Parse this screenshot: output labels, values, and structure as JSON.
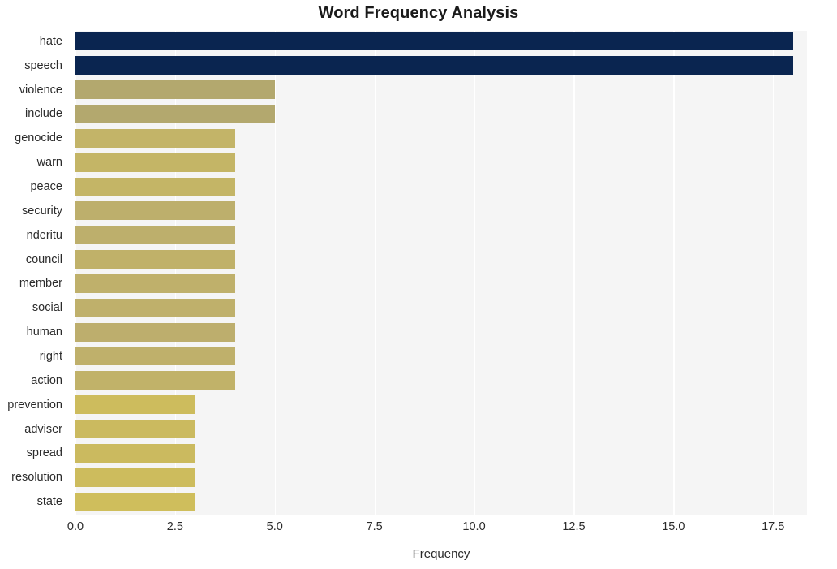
{
  "chart": {
    "title": "Word Frequency Analysis",
    "xlabel": "Frequency",
    "ylabel": ""
  },
  "chart_data": {
    "type": "bar",
    "orientation": "horizontal",
    "title": "Word Frequency Analysis",
    "xlabel": "Frequency",
    "ylabel": "",
    "categories": [
      "hate",
      "speech",
      "violence",
      "include",
      "genocide",
      "warn",
      "peace",
      "security",
      "nderitu",
      "council",
      "member",
      "social",
      "human",
      "right",
      "action",
      "prevention",
      "adviser",
      "spread",
      "resolution",
      "state"
    ],
    "values": [
      18,
      18,
      5,
      5,
      4,
      4,
      4,
      4,
      4,
      4,
      4,
      4,
      4,
      4,
      4,
      3,
      3,
      3,
      3,
      3
    ],
    "bar_colors": [
      "#0a2550",
      "#0a2550",
      "#b3a86e",
      "#b3a86e",
      "#c3b468",
      "#c4b566",
      "#c4b566",
      "#bdaf6c",
      "#bdaf6c",
      "#c0b169",
      "#bfb06b",
      "#bfb06b",
      "#bdae6d",
      "#bfb06b",
      "#c1b269",
      "#cdbc5d",
      "#cbba5f",
      "#cbba5f",
      "#cdbc5d",
      "#cfbe5c"
    ],
    "xticks": [
      0.0,
      2.5,
      5.0,
      7.5,
      10.0,
      12.5,
      15.0,
      17.5
    ],
    "xtick_labels": [
      "0.0",
      "2.5",
      "5.0",
      "7.5",
      "10.0",
      "12.5",
      "15.0",
      "17.5"
    ],
    "xlim": [
      0,
      18.35
    ],
    "grid": "vertical",
    "legend": "none",
    "plot_background": "#f5f5f5",
    "figure_background": "#ffffff"
  }
}
